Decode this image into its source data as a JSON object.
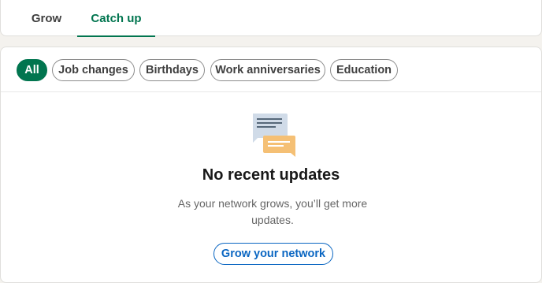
{
  "tabs": {
    "grow": "Grow",
    "catch_up": "Catch up",
    "active": "catch_up"
  },
  "filters": [
    {
      "label": "All",
      "active": true
    },
    {
      "label": "Job changes",
      "active": false
    },
    {
      "label": "Birthdays",
      "active": false
    },
    {
      "label": "Work anniversaries",
      "active": false
    },
    {
      "label": "Education",
      "active": false
    }
  ],
  "empty_state": {
    "icon": "chat-bubbles-icon",
    "title": "No recent updates",
    "description": "As your network grows, you’ll get more updates.",
    "button_label": "Grow your network"
  },
  "colors": {
    "accent_green": "#01754f",
    "link_blue": "#0a66c2",
    "bubble_blue": "#d0dbe8",
    "bubble_orange": "#f5c075"
  }
}
